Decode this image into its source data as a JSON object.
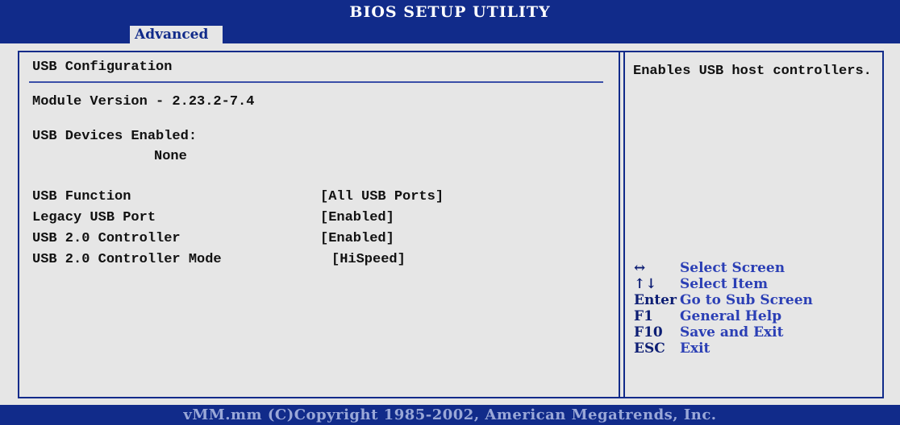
{
  "header": {
    "title": "BIOS SETUP UTILITY",
    "active_tab": "Advanced"
  },
  "main": {
    "section_title": "USB Configuration",
    "module_version": "Module Version - 2.23.2-7.4",
    "devices_label": "USB Devices Enabled:",
    "devices_value": "None",
    "settings": [
      {
        "label": "USB Function",
        "value": "[All USB Ports]"
      },
      {
        "label": "Legacy USB Port",
        "value": "[Enabled]"
      },
      {
        "label": "USB 2.0 Controller",
        "value": "[Enabled]"
      },
      {
        "label": "USB 2.0 Controller Mode",
        "value": "[HiSpeed]"
      }
    ]
  },
  "help": {
    "text": "Enables USB host controllers."
  },
  "keys": [
    {
      "key": "↔",
      "desc": "Select Screen"
    },
    {
      "key": "↑↓",
      "desc": "Select Item"
    },
    {
      "key": "Enter",
      "desc": "Go to Sub Screen"
    },
    {
      "key": "F1",
      "desc": "General Help"
    },
    {
      "key": "F10",
      "desc": "Save and Exit"
    },
    {
      "key": "ESC",
      "desc": "Exit"
    }
  ],
  "footer": {
    "text": "vMM.mm (C)Copyright 1985-2002, American Megatrends, Inc."
  },
  "colors": {
    "bios_blue": "#112b8a",
    "panel_gray": "#e6e6e6",
    "key_text": "#2b3fb5"
  }
}
